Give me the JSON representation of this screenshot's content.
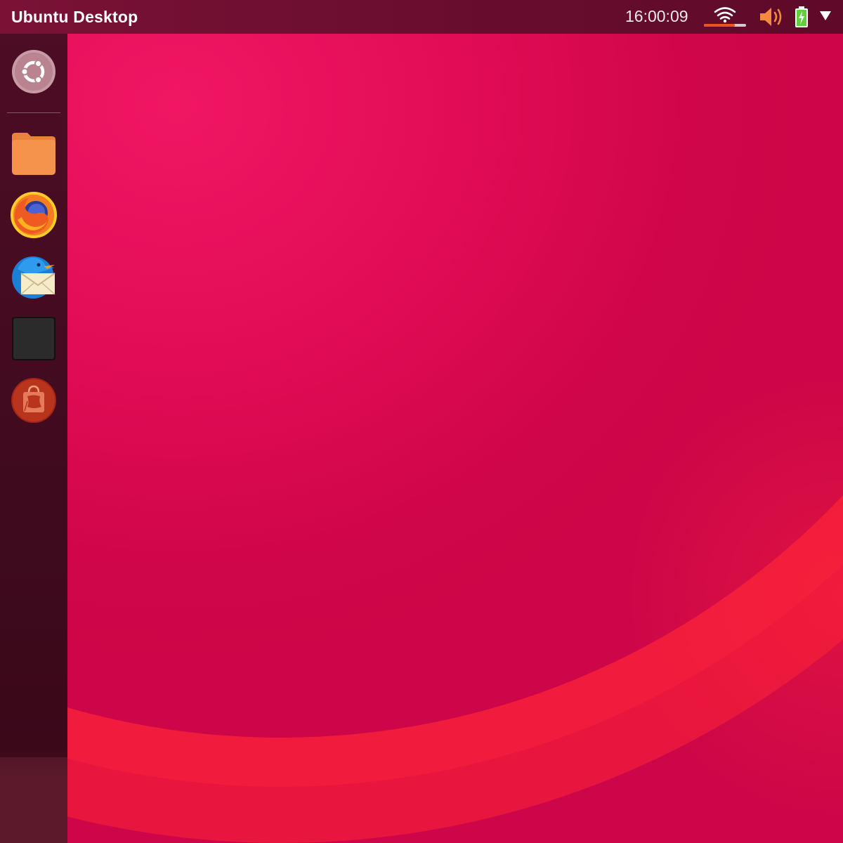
{
  "top_panel": {
    "title": "Ubuntu Desktop",
    "clock": "16:00:09",
    "indicators": {
      "wifi": "wifi-icon",
      "sound": "volume-icon",
      "battery": "battery-charging-icon",
      "menu": "dropdown-arrow-icon"
    }
  },
  "launcher": {
    "items": [
      {
        "name": "ubuntu-dash",
        "icon": "ubuntu-logo-icon"
      },
      {
        "name": "files",
        "icon": "folder-icon"
      },
      {
        "name": "firefox",
        "icon": "firefox-icon"
      },
      {
        "name": "thunderbird",
        "icon": "thunderbird-mail-icon"
      },
      {
        "name": "terminal",
        "icon": "terminal-icon"
      },
      {
        "name": "software-center",
        "icon": "shopping-bag-icon"
      }
    ]
  },
  "colors": {
    "panel": "#6a0d2e",
    "launcher": "#400a1e",
    "wallpaper": "#d6084a",
    "accent": "#e95420"
  }
}
